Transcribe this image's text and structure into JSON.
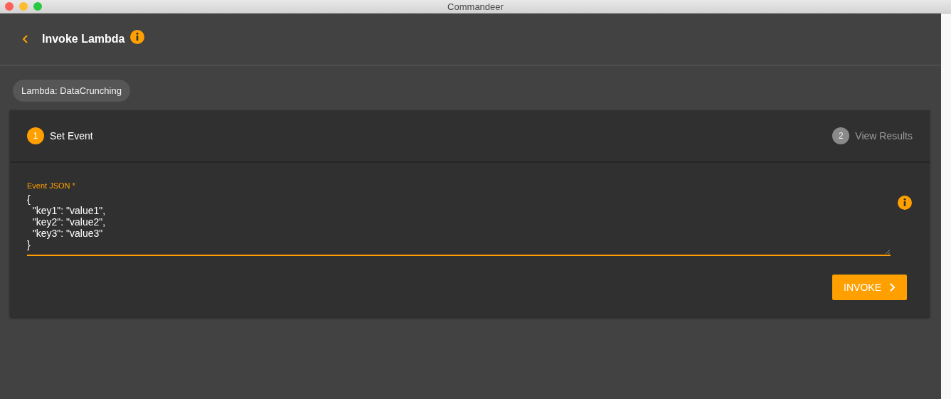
{
  "window": {
    "title": "Commandeer"
  },
  "header": {
    "title": "Invoke Lambda"
  },
  "chip": "Lambda: DataCrunching",
  "steps": [
    {
      "number": "1",
      "label": "Set Event",
      "selected": true
    },
    {
      "number": "2",
      "label": "View Results",
      "selected": false
    }
  ],
  "event_field": {
    "label": "Event JSON *",
    "value": "{\n  \"key1\": \"value1\",\n  \"key2\": \"value2\",\n  \"key3\": \"value3\"\n}"
  },
  "invoke_button": "INVOKE"
}
